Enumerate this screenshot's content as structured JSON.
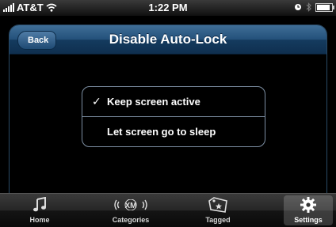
{
  "status_bar": {
    "carrier": "AT&T",
    "time": "1:22 PM"
  },
  "nav": {
    "back_label": "Back",
    "title": "Disable Auto-Lock"
  },
  "options": [
    {
      "label": "Keep screen active",
      "checked": true
    },
    {
      "label": "Let screen go to sleep",
      "checked": false
    }
  ],
  "check_mark": "✓",
  "tabs": [
    {
      "label": "Home",
      "icon": "music-note-icon"
    },
    {
      "label": "Categories",
      "icon": "xm-radio-icon"
    },
    {
      "label": "Tagged",
      "icon": "tag-icon"
    },
    {
      "label": "Settings",
      "icon": "gear-icon",
      "selected": true
    }
  ],
  "colors": {
    "nav_bar": "#23507a",
    "group_border": "#7d8fa3"
  }
}
